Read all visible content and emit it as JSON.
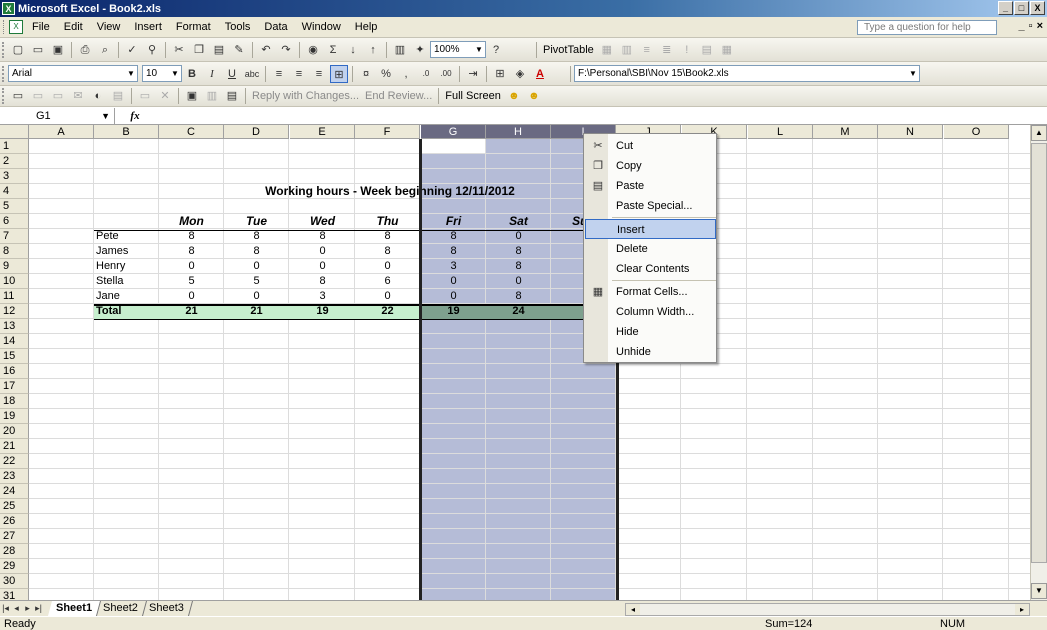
{
  "window": {
    "title": "Microsoft Excel - Book2.xls",
    "min": "_",
    "max": "□",
    "close": "X"
  },
  "menu": {
    "items": [
      "File",
      "Edit",
      "View",
      "Insert",
      "Format",
      "Tools",
      "Data",
      "Window",
      "Help"
    ],
    "question_placeholder": "Type a question for help"
  },
  "toolbar_standard": {
    "zoom": "100%",
    "pivot": "PivotTable"
  },
  "toolbar_format": {
    "font": "Arial",
    "size": "10",
    "path": "F:\\Personal\\SBI\\Nov 15\\Book2.xls"
  },
  "toolbar_review": {
    "reply": "Reply with Changes...",
    "end_review": "End Review...",
    "full_screen": "Full Screen"
  },
  "formula_bar": {
    "name_box": "G1",
    "fx": "fx"
  },
  "columns": [
    "A",
    "B",
    "C",
    "D",
    "E",
    "F",
    "G",
    "H",
    "I",
    "J",
    "K",
    "L",
    "M",
    "N",
    "O"
  ],
  "rows": [
    "1",
    "2",
    "3",
    "4",
    "5",
    "6",
    "7",
    "8",
    "9",
    "10",
    "11",
    "12",
    "13",
    "14",
    "15",
    "16",
    "17",
    "18",
    "19",
    "20",
    "21",
    "22",
    "23",
    "24",
    "25",
    "26",
    "27",
    "28",
    "29",
    "30",
    "31"
  ],
  "sheet": {
    "title": "Working hours - Week beginning 12/11/2012",
    "days": [
      "Mon",
      "Tue",
      "Wed",
      "Thu",
      "Fri",
      "Sat",
      "Sun"
    ],
    "people": [
      {
        "name": "Pete",
        "hours": [
          "8",
          "8",
          "8",
          "8",
          "8",
          "0",
          ""
        ]
      },
      {
        "name": "James",
        "hours": [
          "8",
          "8",
          "0",
          "8",
          "8",
          "8",
          ""
        ]
      },
      {
        "name": "Henry",
        "hours": [
          "0",
          "0",
          "0",
          "0",
          "3",
          "8",
          ""
        ]
      },
      {
        "name": "Stella",
        "hours": [
          "5",
          "5",
          "8",
          "6",
          "0",
          "0",
          ""
        ]
      },
      {
        "name": "Jane",
        "hours": [
          "0",
          "0",
          "3",
          "0",
          "0",
          "8",
          ""
        ]
      }
    ],
    "total_label": "Total",
    "totals": [
      "21",
      "21",
      "19",
      "22",
      "19",
      "24",
      ""
    ]
  },
  "context_menu": {
    "items": [
      "Cut",
      "Copy",
      "Paste",
      "Paste Special...",
      "Insert",
      "Delete",
      "Clear Contents",
      "Format Cells...",
      "Column Width...",
      "Hide",
      "Unhide"
    ],
    "highlighted": "Insert"
  },
  "tabs": [
    "Sheet1",
    "Sheet2",
    "Sheet3"
  ],
  "status": {
    "left": "Ready",
    "sum": "Sum=124",
    "num": "NUM"
  }
}
